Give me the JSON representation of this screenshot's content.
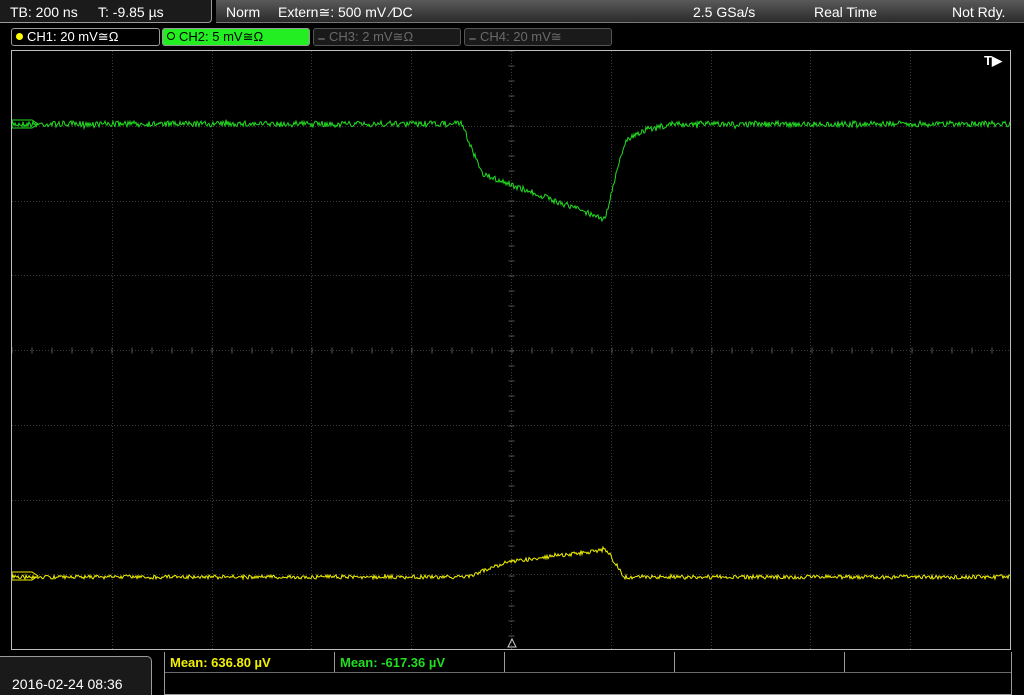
{
  "status": {
    "timebase": "TB: 200 ns",
    "trigger_time": "T: -9.85 µs",
    "mode": "Norm",
    "trigger_source": "Extern≅: 500 mV ⁄DC",
    "sample_rate": "2.5 GSa/s",
    "acq_mode": "Real Time",
    "run_state": "Not Rdy."
  },
  "channels": [
    {
      "label": "CH1: 20 mV≅Ω",
      "color": "#ffff00",
      "active": true,
      "selected": false
    },
    {
      "label": "CH2: 5 mV≅Ω",
      "color": "#00d000",
      "active": true,
      "selected": true
    },
    {
      "label": "CH3: 2 mV≅Ω",
      "color": "#707070",
      "active": false,
      "selected": false
    },
    {
      "label": "CH4: 20 mV≅",
      "color": "#707070",
      "active": false,
      "selected": false
    }
  ],
  "trigger_marker": "T▶",
  "colors": {
    "ch1": "#f0f000",
    "ch2": "#22dd22",
    "grid": "#3a3a3a"
  },
  "measurements": [
    {
      "text": "Mean: 636.80 µV",
      "color": "#f0f000"
    },
    {
      "text": "Mean: -617.36 µV",
      "color": "#22dd22"
    }
  ],
  "datetime": "2016-02-24 08:36"
}
